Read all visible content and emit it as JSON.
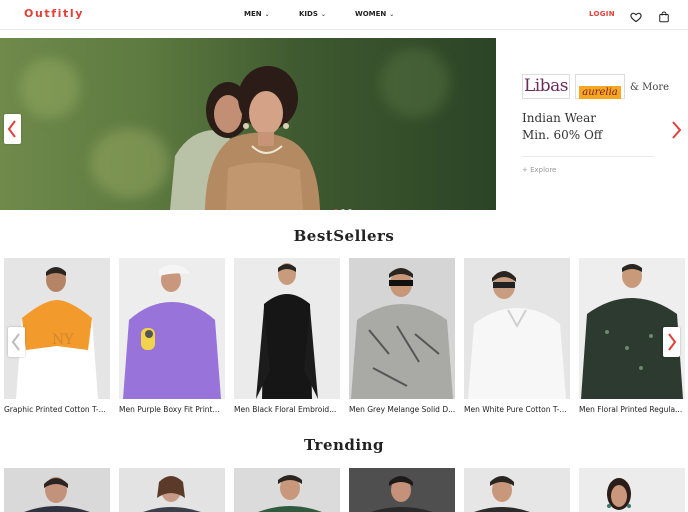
{
  "brand": {
    "logo": "Outfitly"
  },
  "nav": {
    "items": [
      {
        "label": "MEN"
      },
      {
        "label": "KIDS"
      },
      {
        "label": "WOMEN"
      }
    ],
    "login_label": "LOGIN"
  },
  "promo": {
    "brand1": "Libas",
    "brand2": "aurelia",
    "more": "& More",
    "title": "Indian Wear",
    "subtitle": "Min. 60% Off",
    "explore": "+ Explore"
  },
  "bestsellers": {
    "title": "BestSellers",
    "products": [
      {
        "name": "Graphic Printed Cotton T-..."
      },
      {
        "name": "Men Purple Boxy Fit Print..."
      },
      {
        "name": "Men Black Floral Embroid..."
      },
      {
        "name": "Men Grey Melange Solid D..."
      },
      {
        "name": "Men White Pure Cotton T-..."
      },
      {
        "name": "Men Floral Printed Regula..."
      }
    ]
  },
  "trending": {
    "title": "Trending"
  },
  "colors": {
    "accent": "#e0413a"
  }
}
